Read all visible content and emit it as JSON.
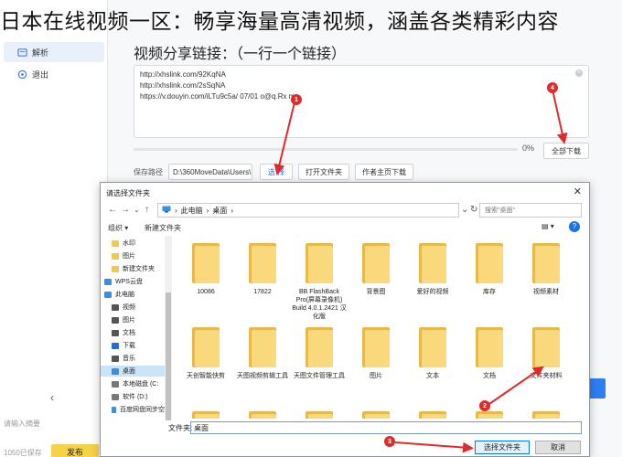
{
  "banner": {
    "text": "日本在线视频一区：畅享海量高清视频，涵盖各类精彩内容"
  },
  "sidebar": {
    "items": [
      {
        "label": "解析",
        "icon": "link-icon"
      },
      {
        "label": "退出",
        "icon": "power-icon"
      }
    ],
    "back_arrow": "‹",
    "bottom_input_placeholder": "请输入摘要",
    "bottom_status": "1050已保存",
    "publish_label": "发布"
  },
  "main": {
    "section_title": "视频分享链接：（一行一个链接）",
    "links": [
      "http://xhslink.com/92KqNA",
      "http://xhslink.com/2sSqNA",
      "https://v.douyin.com/iLTu9c5a/ 07/01 o@q.Rx m…"
    ],
    "progress_percent": 0,
    "progress_text": "0%",
    "download_all_label": "全部下载",
    "save_path_label": "保存路径",
    "save_path_value": "D:\\360MoveData\\Users\\",
    "choose_label": "选 择",
    "open_folder_label": "打开文件夹",
    "author_page_label": "作者主页下载"
  },
  "dialog": {
    "title": "请选择文件夹",
    "close": "✕",
    "breadcrumb": [
      "此电脑",
      "桌面"
    ],
    "search_placeholder": "搜索\"桌面\"",
    "organize_label": "组织 ▾",
    "new_folder_label": "新建文件夹",
    "tree_items": [
      {
        "label": "水印",
        "icon": "folder-icon",
        "indent": 2
      },
      {
        "label": "图片",
        "icon": "folder-icon",
        "indent": 2
      },
      {
        "label": "新建文件夹",
        "icon": "folder-icon",
        "indent": 2
      },
      {
        "label": "WPS云盘",
        "icon": "cloud-icon",
        "indent": 1
      },
      {
        "label": "此电脑",
        "icon": "computer-icon",
        "indent": 1
      },
      {
        "label": "视频",
        "icon": "video-icon",
        "indent": 2
      },
      {
        "label": "图片",
        "icon": "picture-icon",
        "indent": 2
      },
      {
        "label": "文档",
        "icon": "document-icon",
        "indent": 2
      },
      {
        "label": "下载",
        "icon": "download-icon",
        "indent": 2
      },
      {
        "label": "音乐",
        "icon": "music-icon",
        "indent": 2
      },
      {
        "label": "桌面",
        "icon": "desktop-icon",
        "indent": 2,
        "selected": true
      },
      {
        "label": "本地磁盘 (C:",
        "icon": "drive-icon",
        "indent": 2
      },
      {
        "label": "软件 (D:)",
        "icon": "drive-icon",
        "indent": 2
      },
      {
        "label": "百度网盘同步空",
        "icon": "cloud-icon",
        "indent": 2
      }
    ],
    "files": [
      "10086",
      "17822",
      "BB FlashBack Pro(屏幕录像机) Build 4.0.1.2421 汉化版",
      "背景图",
      "爱好的视频",
      "库存",
      "视频素材",
      "天创智能快剪",
      "天图视频剪辑工具",
      "天图文件管理工具",
      "图片",
      "文本",
      "文档",
      "文件夹材料",
      "",
      "",
      "",
      "",
      "",
      "",
      ""
    ],
    "filename_label": "文件夹:",
    "filename_value": "桌面",
    "select_button_label": "选择文件夹",
    "cancel_button_label": "取消"
  },
  "annotations": [
    "1",
    "2",
    "3",
    "4"
  ],
  "colors": {
    "annotation_red": "#e02b2b",
    "folder_yellow": "#f9d97b",
    "accent_blue": "#2d7ef7"
  }
}
